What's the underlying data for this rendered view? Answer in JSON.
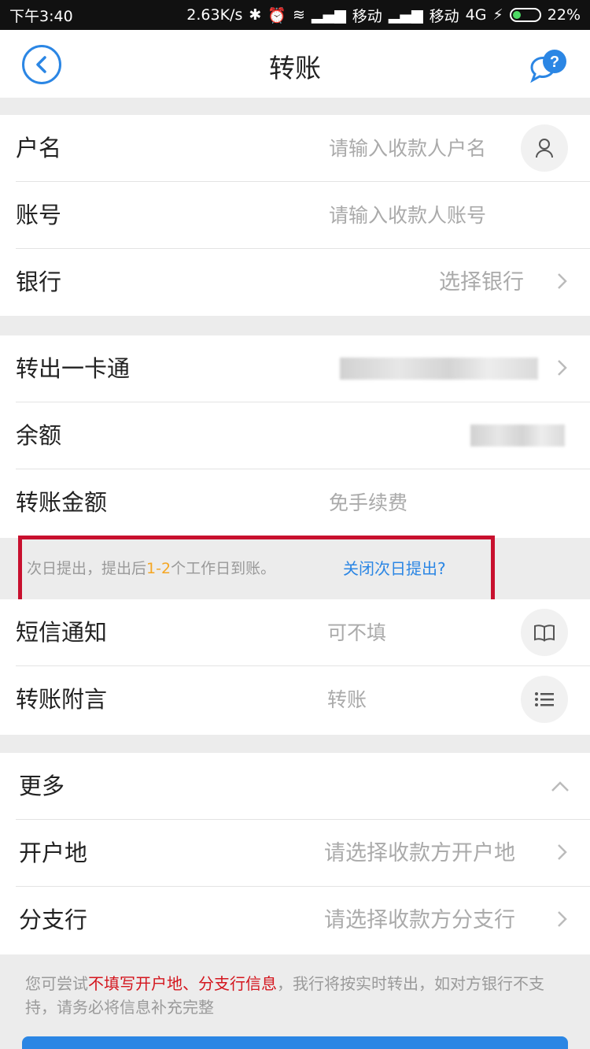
{
  "status_bar": {
    "time": "下午3:40",
    "speed": "2.63K/s",
    "carrier1": "移动",
    "carrier2": "移动",
    "network": "4G",
    "battery": "22%"
  },
  "nav": {
    "title": "转账",
    "back_icon": "back-circle-icon",
    "help_icon": "help-chat-icon"
  },
  "payee": {
    "name_label": "户名",
    "name_placeholder": "请输入收款人户名",
    "account_label": "账号",
    "account_placeholder": "请输入收款人账号",
    "bank_label": "银行",
    "bank_value": "选择银行"
  },
  "source": {
    "card_label": "转出一卡通",
    "balance_label": "余额",
    "amount_label": "转账金额",
    "amount_placeholder": "免手续费"
  },
  "notice": {
    "text_before": "次日提出，提出后",
    "text_highlight": "1-2",
    "text_after": "个工作日到账。",
    "link": "关闭次日提出?"
  },
  "extra": {
    "sms_label": "短信通知",
    "sms_placeholder": "可不填",
    "memo_label": "转账附言",
    "memo_placeholder": "转账"
  },
  "more": {
    "label": "更多",
    "open_place_label": "开户地",
    "open_place_value": "请选择收款方开户地",
    "branch_label": "分支行",
    "branch_value": "请选择收款方分支行"
  },
  "footer": {
    "note_before": "您可尝试",
    "note_red": "不填写开户地、分支行信息",
    "note_after": "，我行将按实时转出，如对方银行不支持，请务必将信息补充完整"
  },
  "colors": {
    "accent": "#2b86e4",
    "highlight": "#f5a623",
    "warning_red": "#d4161e",
    "frame_red": "#c8102e"
  }
}
